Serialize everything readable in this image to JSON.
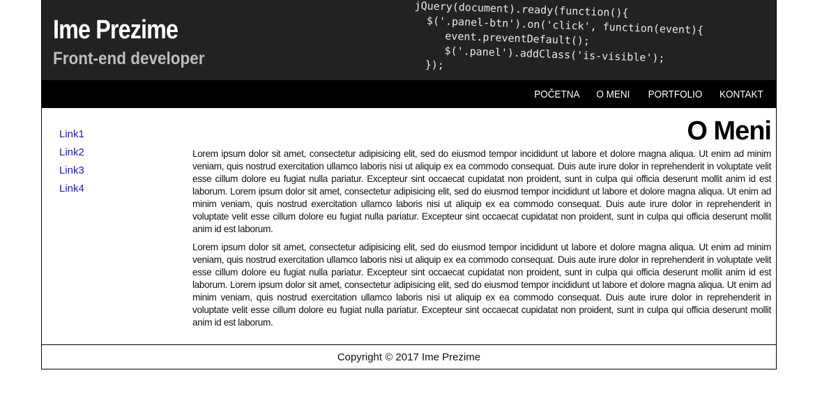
{
  "header": {
    "name": "Ime Prezime",
    "role": "Front-end developer",
    "code_lines": [
      "jQuery(document).ready(function(){",
      "",
      "  $('.panel-btn').on('click', function(event){",
      "     event.preventDefault();",
      "     $('.panel').addClass('is-visible');",
      "  });"
    ]
  },
  "nav": {
    "items": [
      "POČETNA",
      "O MENI",
      "PORTFOLIO",
      "KONTAKT"
    ]
  },
  "sidebar": {
    "links": [
      "Link1",
      "Link2",
      "Link3",
      "Link4"
    ]
  },
  "main": {
    "title": "O Meni",
    "paragraphs": [
      "Lorem ipsum dolor sit amet, consectetur adipisicing elit, sed do eiusmod tempor incididunt ut labore et dolore magna aliqua. Ut enim ad minim veniam, quis nostrud exercitation ullamco laboris nisi ut aliquip ex ea commodo consequat. Duis aute irure dolor in reprehenderit in voluptate velit esse cillum dolore eu fugiat nulla pariatur. Excepteur sint occaecat cupidatat non proident, sunt in culpa qui officia deserunt mollit anim id est laborum. Lorem ipsum dolor sit amet, consectetur adipisicing elit, sed do eiusmod tempor incididunt ut labore et dolore magna aliqua. Ut enim ad minim veniam, quis nostrud exercitation ullamco laboris nisi ut aliquip ex ea commodo consequat. Duis aute irure dolor in reprehenderit in voluptate velit esse cillum dolore eu fugiat nulla pariatur. Excepteur sint occaecat cupidatat non proident, sunt in culpa qui officia deserunt mollit anim id est laborum.",
      "Lorem ipsum dolor sit amet, consectetur adipisicing elit, sed do eiusmod tempor incididunt ut labore et dolore magna aliqua. Ut enim ad minim veniam, quis nostrud exercitation ullamco laboris nisi ut aliquip ex ea commodo consequat. Duis aute irure dolor in reprehenderit in voluptate velit esse cillum dolore eu fugiat nulla pariatur. Excepteur sint occaecat cupidatat non proident, sunt in culpa qui officia deserunt mollit anim id est laborum. Lorem ipsum dolor sit amet, consectetur adipisicing elit, sed do eiusmod tempor incididunt ut labore et dolore magna aliqua. Ut enim ad minim veniam, quis nostrud exercitation ullamco laboris nisi ut aliquip ex ea commodo consequat. Duis aute irure dolor in reprehenderit in voluptate velit esse cillum dolore eu fugiat nulla pariatur. Excepteur sint occaecat cupidatat non proident, sunt in culpa qui officia deserunt mollit anim id est laborum."
    ]
  },
  "footer": {
    "copyright": "Copyright © 2017 Ime Prezime"
  },
  "colors": {
    "banner_bg": "#222222",
    "nav_bg": "#000000",
    "link": "#1a1acc"
  }
}
